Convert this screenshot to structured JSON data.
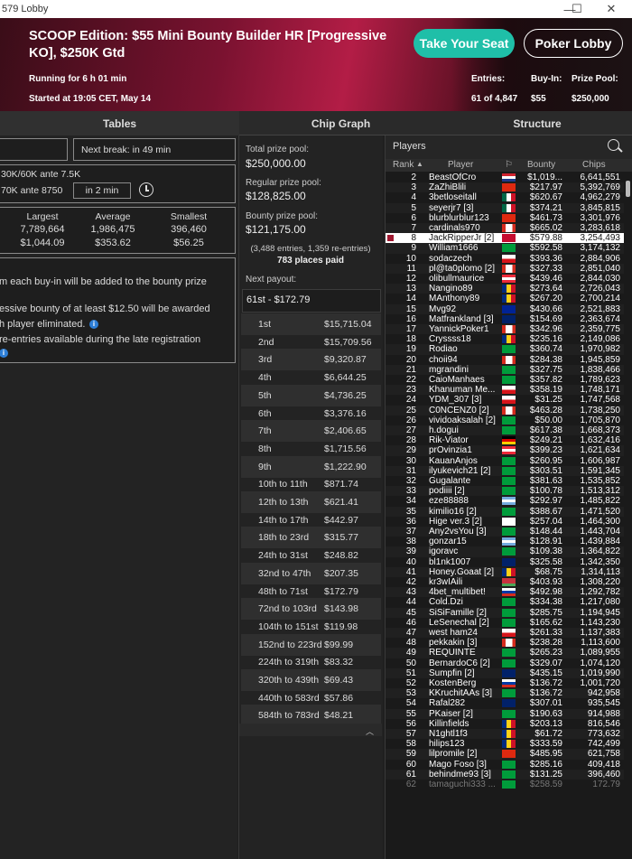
{
  "window": {
    "title": "579 Lobby",
    "minimize": "—",
    "maximize": "☐",
    "close": "✕"
  },
  "banner": {
    "title": "SCOOP Edition: $55 Mini Bounty Builder HR [Progressive KO], $250K Gtd",
    "running": "Running for 6 h 01 min",
    "started": "Started at 19:05 CET, May 14",
    "take_seat": "Take Your Seat",
    "poker_lobby": "Poker Lobby",
    "entries_label": "Entries:",
    "buyin_label": "Buy-In:",
    "prize_label": "Prize Pool:",
    "entries_value": "61 of 4,847",
    "buyin_value": "$55",
    "prize_value": "$250,000"
  },
  "tabs": [
    "Tables",
    "Chip Graph",
    "Structure"
  ],
  "left": {
    "next_break": "Next break: in 49 min",
    "blinds_current": "30K/60K ante 7.5K",
    "blinds_next": "70K ante 8750",
    "blinds_timer": "in 2 min",
    "stacks_headers": [
      "Largest",
      "Average",
      "Smallest"
    ],
    "stacks_chips": [
      "7,789,664",
      "1,986,475",
      "396,460"
    ],
    "stacks_bounty": [
      "$1,044.09",
      "$353.62",
      "$56.25"
    ],
    "info_lines": [
      "m each buy-in will be added to the bounty prize",
      "essive bounty of at least $12.50 will be awarded",
      "h player eliminated.",
      "re-entries available during the late registration"
    ]
  },
  "mid": {
    "total_label": "Total prize pool:",
    "total_value": "$250,000.00",
    "regular_label": "Regular prize pool:",
    "regular_value": "$128,825.00",
    "bounty_label": "Bounty prize pool:",
    "bounty_value": "$121,175.00",
    "entries_note": "(3,488 entries, 1,359 re-entries)",
    "places_paid": "783 places paid",
    "next_payout_label": "Next payout:",
    "next_payout_value": "61st - $172.79",
    "payouts": [
      {
        "place": "1st",
        "amount": "$15,715.04"
      },
      {
        "place": "2nd",
        "amount": "$15,709.56"
      },
      {
        "place": "3rd",
        "amount": "$9,320.87"
      },
      {
        "place": "4th",
        "amount": "$6,644.25"
      },
      {
        "place": "5th",
        "amount": "$4,736.25"
      },
      {
        "place": "6th",
        "amount": "$3,376.16"
      },
      {
        "place": "7th",
        "amount": "$2,406.65"
      },
      {
        "place": "8th",
        "amount": "$1,715.56"
      },
      {
        "place": "9th",
        "amount": "$1,222.90"
      },
      {
        "place": "10th to 11th",
        "amount": "$871.74"
      },
      {
        "place": "12th to 13th",
        "amount": "$621.41"
      },
      {
        "place": "14th to 17th",
        "amount": "$442.97"
      },
      {
        "place": "18th to 23rd",
        "amount": "$315.77"
      },
      {
        "place": "24th to 31st",
        "amount": "$248.82"
      },
      {
        "place": "32nd to 47th",
        "amount": "$207.35"
      },
      {
        "place": "48th to 71st",
        "amount": "$172.79"
      },
      {
        "place": "72nd to 103rd",
        "amount": "$143.98"
      },
      {
        "place": "104th to 151st",
        "amount": "$119.98"
      },
      {
        "place": "152nd to 223rd",
        "amount": "$99.99"
      },
      {
        "place": "224th to 319th",
        "amount": "$83.32"
      },
      {
        "place": "320th to 439th",
        "amount": "$69.43"
      },
      {
        "place": "440th to 583rd",
        "amount": "$57.86"
      },
      {
        "place": "584th to 783rd",
        "amount": "$48.21"
      }
    ]
  },
  "players": {
    "title": "Players",
    "headers": {
      "rank": "Rank",
      "player": "Player",
      "bounty": "Bounty",
      "chips": "Chips"
    },
    "rows": [
      {
        "rank": "2",
        "name": "BeastOfCro",
        "flag": "hr",
        "bounty": "$1,019...",
        "chips": "6,641,551"
      },
      {
        "rank": "3",
        "name": "ZaZhiBlili",
        "flag": "cn",
        "bounty": "$217.97",
        "chips": "5,392,769"
      },
      {
        "rank": "4",
        "name": "3betloseitall",
        "flag": "mx",
        "bounty": "$620.67",
        "chips": "4,962,279"
      },
      {
        "rank": "5",
        "name": "seyerjr7 [3]",
        "flag": "mx",
        "bounty": "$374.21",
        "chips": "3,845,815"
      },
      {
        "rank": "6",
        "name": "blurblurblur123",
        "flag": "cn",
        "bounty": "$461.73",
        "chips": "3,301,976"
      },
      {
        "rank": "7",
        "name": "cardinals970",
        "flag": "ca",
        "bounty": "$665.02",
        "chips": "3,283,618"
      },
      {
        "rank": "8",
        "name": "JackRipperJr [2]",
        "flag": "dk",
        "bounty": "$579.88",
        "chips": "3,254,493",
        "me": true
      },
      {
        "rank": "9",
        "name": "William1666",
        "flag": "br",
        "bounty": "$592.58",
        "chips": "3,174,132"
      },
      {
        "rank": "10",
        "name": "sodaczech",
        "flag": "cz",
        "bounty": "$393.36",
        "chips": "2,884,906"
      },
      {
        "rank": "11",
        "name": "pl@ta0plomo [2]",
        "flag": "ca",
        "bounty": "$327.33",
        "chips": "2,851,040"
      },
      {
        "rank": "12",
        "name": "olibullmaurice",
        "flag": "at",
        "bounty": "$439.46",
        "chips": "2,844,030"
      },
      {
        "rank": "13",
        "name": "Nangino89",
        "flag": "ro",
        "bounty": "$273.64",
        "chips": "2,726,043"
      },
      {
        "rank": "14",
        "name": "MAnthony89",
        "flag": "ro",
        "bounty": "$267.20",
        "chips": "2,700,214"
      },
      {
        "rank": "15",
        "name": "Mvg92",
        "flag": "ba",
        "bounty": "$430.66",
        "chips": "2,521,883"
      },
      {
        "rank": "16",
        "name": "Matfrankland [3]",
        "flag": "gb",
        "bounty": "$154.69",
        "chips": "2,363,674"
      },
      {
        "rank": "17",
        "name": "YannickPoker1",
        "flag": "ca",
        "bounty": "$342.96",
        "chips": "2,359,775"
      },
      {
        "rank": "18",
        "name": "Cryssss18",
        "flag": "ro",
        "bounty": "$235.16",
        "chips": "2,149,086"
      },
      {
        "rank": "19",
        "name": "Rodiao",
        "flag": "br",
        "bounty": "$360.74",
        "chips": "1,970,982"
      },
      {
        "rank": "20",
        "name": "choii94",
        "flag": "ca",
        "bounty": "$284.38",
        "chips": "1,945,859"
      },
      {
        "rank": "21",
        "name": "mgrandini",
        "flag": "br",
        "bounty": "$327.75",
        "chips": "1,838,466"
      },
      {
        "rank": "22",
        "name": "CaioManhaes",
        "flag": "br",
        "bounty": "$357.82",
        "chips": "1,789,623"
      },
      {
        "rank": "23",
        "name": "Khanuman Me...",
        "flag": "cz",
        "bounty": "$358.19",
        "chips": "1,748,171"
      },
      {
        "rank": "24",
        "name": "YDM_307 [3]",
        "flag": "cz",
        "bounty": "$31.25",
        "chips": "1,747,568"
      },
      {
        "rank": "25",
        "name": "C0NCENZ0 [2]",
        "flag": "ca",
        "bounty": "$463.28",
        "chips": "1,738,250"
      },
      {
        "rank": "26",
        "name": "vividoaksalah [2]",
        "flag": "br",
        "bounty": "$50.00",
        "chips": "1,705,870"
      },
      {
        "rank": "27",
        "name": "h.dogui",
        "flag": "br",
        "bounty": "$617.38",
        "chips": "1,668,373"
      },
      {
        "rank": "28",
        "name": "Rik-Viator",
        "flag": "de",
        "bounty": "$249.21",
        "chips": "1,632,416"
      },
      {
        "rank": "29",
        "name": "prOvinzia1",
        "flag": "at",
        "bounty": "$399.23",
        "chips": "1,621,634"
      },
      {
        "rank": "30",
        "name": "KauanAnjos",
        "flag": "br",
        "bounty": "$260.95",
        "chips": "1,606,987"
      },
      {
        "rank": "31",
        "name": "ilyukevich21 [2]",
        "flag": "br",
        "bounty": "$303.51",
        "chips": "1,591,345"
      },
      {
        "rank": "32",
        "name": "Gugalante",
        "flag": "br",
        "bounty": "$381.63",
        "chips": "1,535,852"
      },
      {
        "rank": "33",
        "name": "podiiii [2]",
        "flag": "br",
        "bounty": "$100.78",
        "chips": "1,513,312"
      },
      {
        "rank": "34",
        "name": "eze88888",
        "flag": "ar",
        "bounty": "$292.97",
        "chips": "1,485,822"
      },
      {
        "rank": "35",
        "name": "kimilio16 [2]",
        "flag": "br",
        "bounty": "$388.67",
        "chips": "1,471,520"
      },
      {
        "rank": "36",
        "name": "Hige ver.3 [2]",
        "flag": "jp",
        "bounty": "$257.04",
        "chips": "1,464,300"
      },
      {
        "rank": "37",
        "name": "Any2vsYou [3]",
        "flag": "br",
        "bounty": "$148.44",
        "chips": "1,443,704"
      },
      {
        "rank": "38",
        "name": "gonzar15",
        "flag": "ar",
        "bounty": "$128.91",
        "chips": "1,439,884"
      },
      {
        "rank": "39",
        "name": "igoravc",
        "flag": "br",
        "bounty": "$109.38",
        "chips": "1,364,822"
      },
      {
        "rank": "40",
        "name": "bl1nk1007",
        "flag": "gb",
        "bounty": "$325.58",
        "chips": "1,342,350"
      },
      {
        "rank": "41",
        "name": "Honey.Goaat [2]",
        "flag": "ro",
        "bounty": "$68.75",
        "chips": "1,314,113"
      },
      {
        "rank": "42",
        "name": "kr3wIAili",
        "flag": "by",
        "bounty": "$403.93",
        "chips": "1,308,220"
      },
      {
        "rank": "43",
        "name": "4bet_multibet!",
        "flag": "ru",
        "bounty": "$492.98",
        "chips": "1,292,782"
      },
      {
        "rank": "44",
        "name": "Cold.Dzi",
        "flag": "br",
        "bounty": "$334.38",
        "chips": "1,217,080"
      },
      {
        "rank": "45",
        "name": "SiSiFamille [2]",
        "flag": "br",
        "bounty": "$285.75",
        "chips": "1,194,945"
      },
      {
        "rank": "46",
        "name": "LeSenechal [2]",
        "flag": "br",
        "bounty": "$165.62",
        "chips": "1,143,230"
      },
      {
        "rank": "47",
        "name": "west ham24",
        "flag": "cz",
        "bounty": "$261.33",
        "chips": "1,137,383"
      },
      {
        "rank": "48",
        "name": "pekkakin [3]",
        "flag": "ca",
        "bounty": "$238.28",
        "chips": "1,113,600"
      },
      {
        "rank": "49",
        "name": "REQUINTE",
        "flag": "br",
        "bounty": "$265.23",
        "chips": "1,089,955"
      },
      {
        "rank": "50",
        "name": "BernardoC6 [2]",
        "flag": "br",
        "bounty": "$329.07",
        "chips": "1,074,120"
      },
      {
        "rank": "51",
        "name": "Sumpfin [2]",
        "flag": "gb",
        "bounty": "$435.15",
        "chips": "1,019,990"
      },
      {
        "rank": "52",
        "name": "KostenBerg",
        "flag": "ru",
        "bounty": "$136.72",
        "chips": "1,001,720"
      },
      {
        "rank": "53",
        "name": "KKruchitAAs [3]",
        "flag": "br",
        "bounty": "$136.72",
        "chips": "942,958"
      },
      {
        "rank": "54",
        "name": "Rafal282",
        "flag": "gb",
        "bounty": "$307.01",
        "chips": "935,545"
      },
      {
        "rank": "55",
        "name": "PKaiser [2]",
        "flag": "br",
        "bounty": "$190.63",
        "chips": "914,988"
      },
      {
        "rank": "56",
        "name": "Killinfields",
        "flag": "ro",
        "bounty": "$203.13",
        "chips": "816,546"
      },
      {
        "rank": "57",
        "name": "N1ghtl1f3",
        "flag": "ro",
        "bounty": "$61.72",
        "chips": "773,632"
      },
      {
        "rank": "58",
        "name": "hilips123",
        "flag": "ro",
        "bounty": "$333.59",
        "chips": "742,499"
      },
      {
        "rank": "59",
        "name": "lilpromile [2]",
        "flag": "cn",
        "bounty": "$485.95",
        "chips": "621,758"
      },
      {
        "rank": "60",
        "name": "Mago Foso [3]",
        "flag": "br",
        "bounty": "$285.16",
        "chips": "409,418"
      },
      {
        "rank": "61",
        "name": "behindme93 [3]",
        "flag": "br",
        "bounty": "$131.25",
        "chips": "396,460"
      },
      {
        "rank": "62",
        "name": "tamaguchi333 ...",
        "flag": "br",
        "bounty": "$258.59",
        "chips": "172.79",
        "dim": true
      }
    ]
  }
}
